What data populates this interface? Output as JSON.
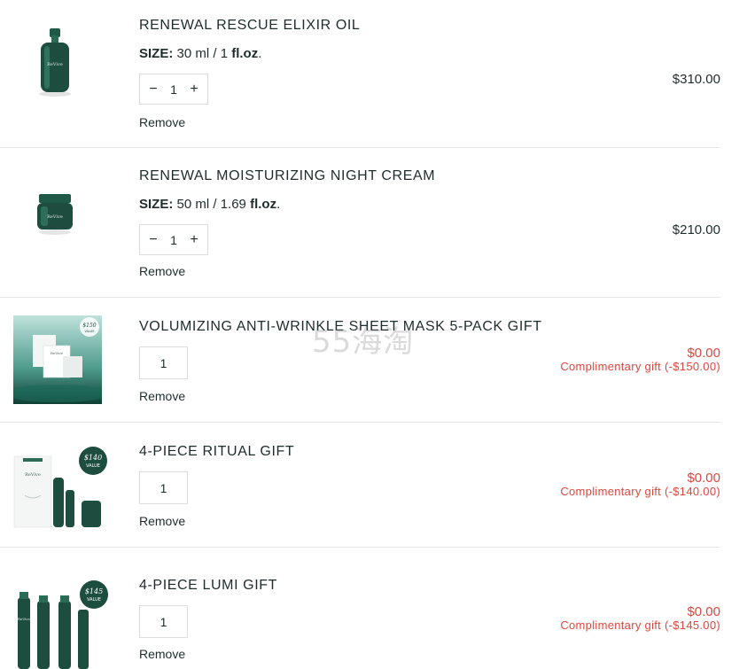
{
  "cart": {
    "items": [
      {
        "name": "RENEWAL RESCUE ELIXIR OIL",
        "size_label": "SIZE:",
        "size_value": "30 ml / 1",
        "size_unit": "fl.oz",
        "size_end": ".",
        "quantity": "1",
        "minus": "−",
        "plus": "+",
        "remove": "Remove",
        "price": "$310.00"
      },
      {
        "name": "RENEWAL MOISTURIZING NIGHT CREAM",
        "size_label": "SIZE:",
        "size_value": "50 ml / 1.69",
        "size_unit": "fl.oz",
        "size_end": ".",
        "quantity": "1",
        "minus": "−",
        "plus": "+",
        "remove": "Remove",
        "price": "$210.00"
      },
      {
        "name": "VOLUMIZING ANTI-WRINKLE SHEET MASK 5-PACK GIFT",
        "quantity": "1",
        "remove": "Remove",
        "price": "$0.00",
        "gift_note": "Complimentary gift (-$150.00)",
        "badge_value": "$150",
        "badge_label": "VALUE"
      },
      {
        "name": "4-PIECE RITUAL GIFT",
        "quantity": "1",
        "remove": "Remove",
        "price": "$0.00",
        "gift_note": "Complimentary gift (-$140.00)",
        "badge_value": "$140",
        "badge_label": "VALUE"
      },
      {
        "name": "4-PIECE LUMI GIFT",
        "quantity": "1",
        "remove": "Remove",
        "price": "$0.00",
        "gift_note": "Complimentary gift (-$145.00)",
        "badge_value": "$145",
        "badge_label": "VALUE"
      }
    ]
  },
  "watermark": "55海淘",
  "colors": {
    "brand_green": "#1d4d3e",
    "gift_red": "#e0453c",
    "text": "#1f2c2b"
  }
}
